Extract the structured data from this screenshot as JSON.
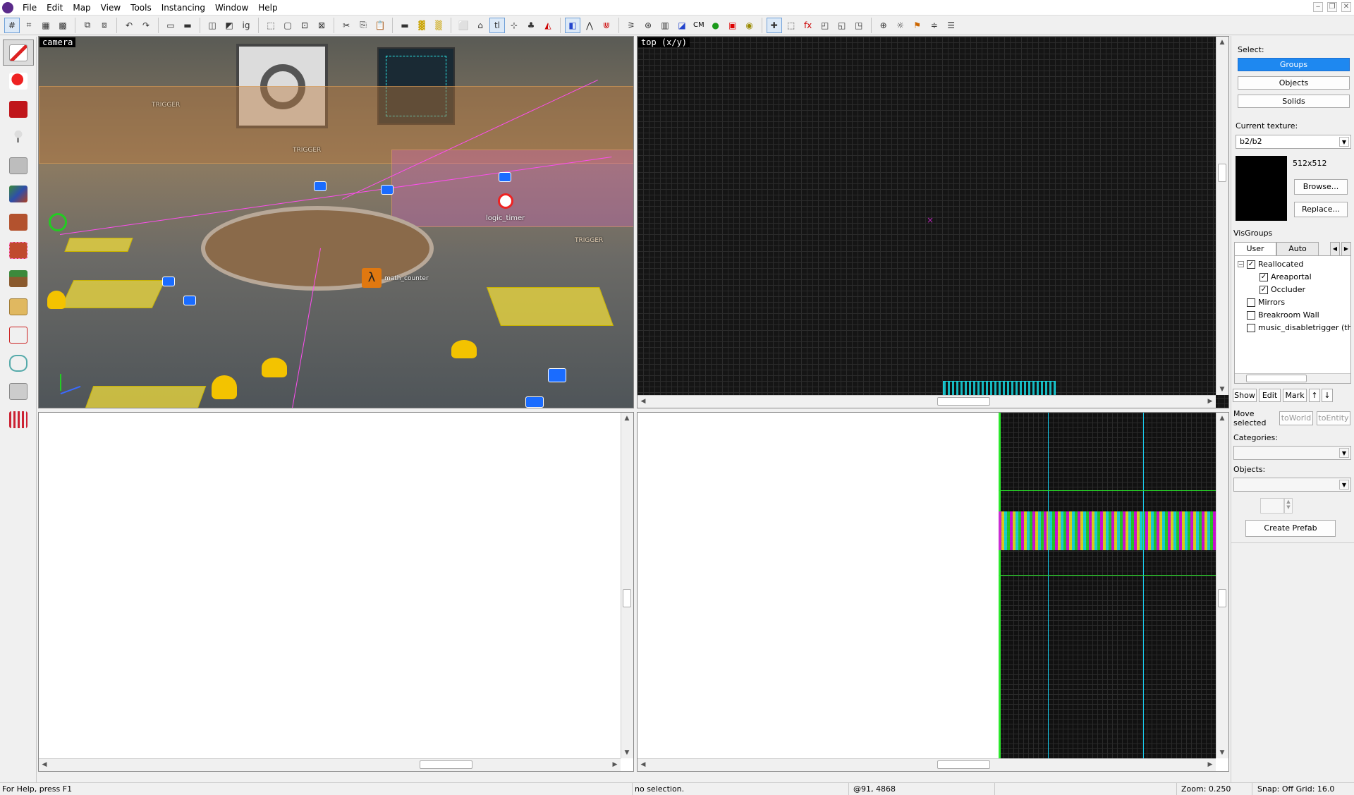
{
  "menu": [
    "File",
    "Edit",
    "Map",
    "View",
    "Tools",
    "Instancing",
    "Window",
    "Help"
  ],
  "toolbar": {
    "cm_label": "CM"
  },
  "viewports": {
    "camera_label": "camera",
    "top_label": "top (x/y)",
    "camera_entities": {
      "logic_timer": "logic_timer",
      "math_counter": "math_counter",
      "trigger": "TRIGGER"
    }
  },
  "right_panel": {
    "select_label": "Select:",
    "groups_label": "Groups",
    "objects_label": "Objects",
    "solids_label": "Solids",
    "current_texture_label": "Current texture:",
    "current_texture_value": "b2/b2",
    "texture_size": "512x512",
    "browse_label": "Browse...",
    "replace_label": "Replace...",
    "visgroups_label": "VisGroups",
    "tab_user": "User",
    "tab_auto": "Auto",
    "visgroups": [
      {
        "label": "Reallocated",
        "checked": true
      },
      {
        "label": "Areaportal",
        "checked": true
      },
      {
        "label": "Occluder",
        "checked": true
      },
      {
        "label": "Mirrors",
        "checked": false
      },
      {
        "label": "Breakroom Wall",
        "checked": false
      },
      {
        "label": "music_disabletrigger (th",
        "checked": false
      }
    ],
    "show_label": "Show",
    "edit_label": "Edit",
    "mark_label": "Mark",
    "move_selected_label": "Move selected",
    "to_world_label": "toWorld",
    "to_entity_label": "toEntity",
    "categories_label": "Categories:",
    "objects_field_label": "Objects:",
    "create_prefab_label": "Create Prefab"
  },
  "status": {
    "help": "For Help, press F1",
    "selection": "no selection.",
    "coords": "@91, 4868",
    "zoom": "Zoom: 0.250",
    "snap": "Snap: Off Grid: 16.0"
  },
  "colors": {
    "selected_button": "#1e88f0",
    "viewport_grid_bg": "#151515",
    "texture_preview": "#000000"
  }
}
